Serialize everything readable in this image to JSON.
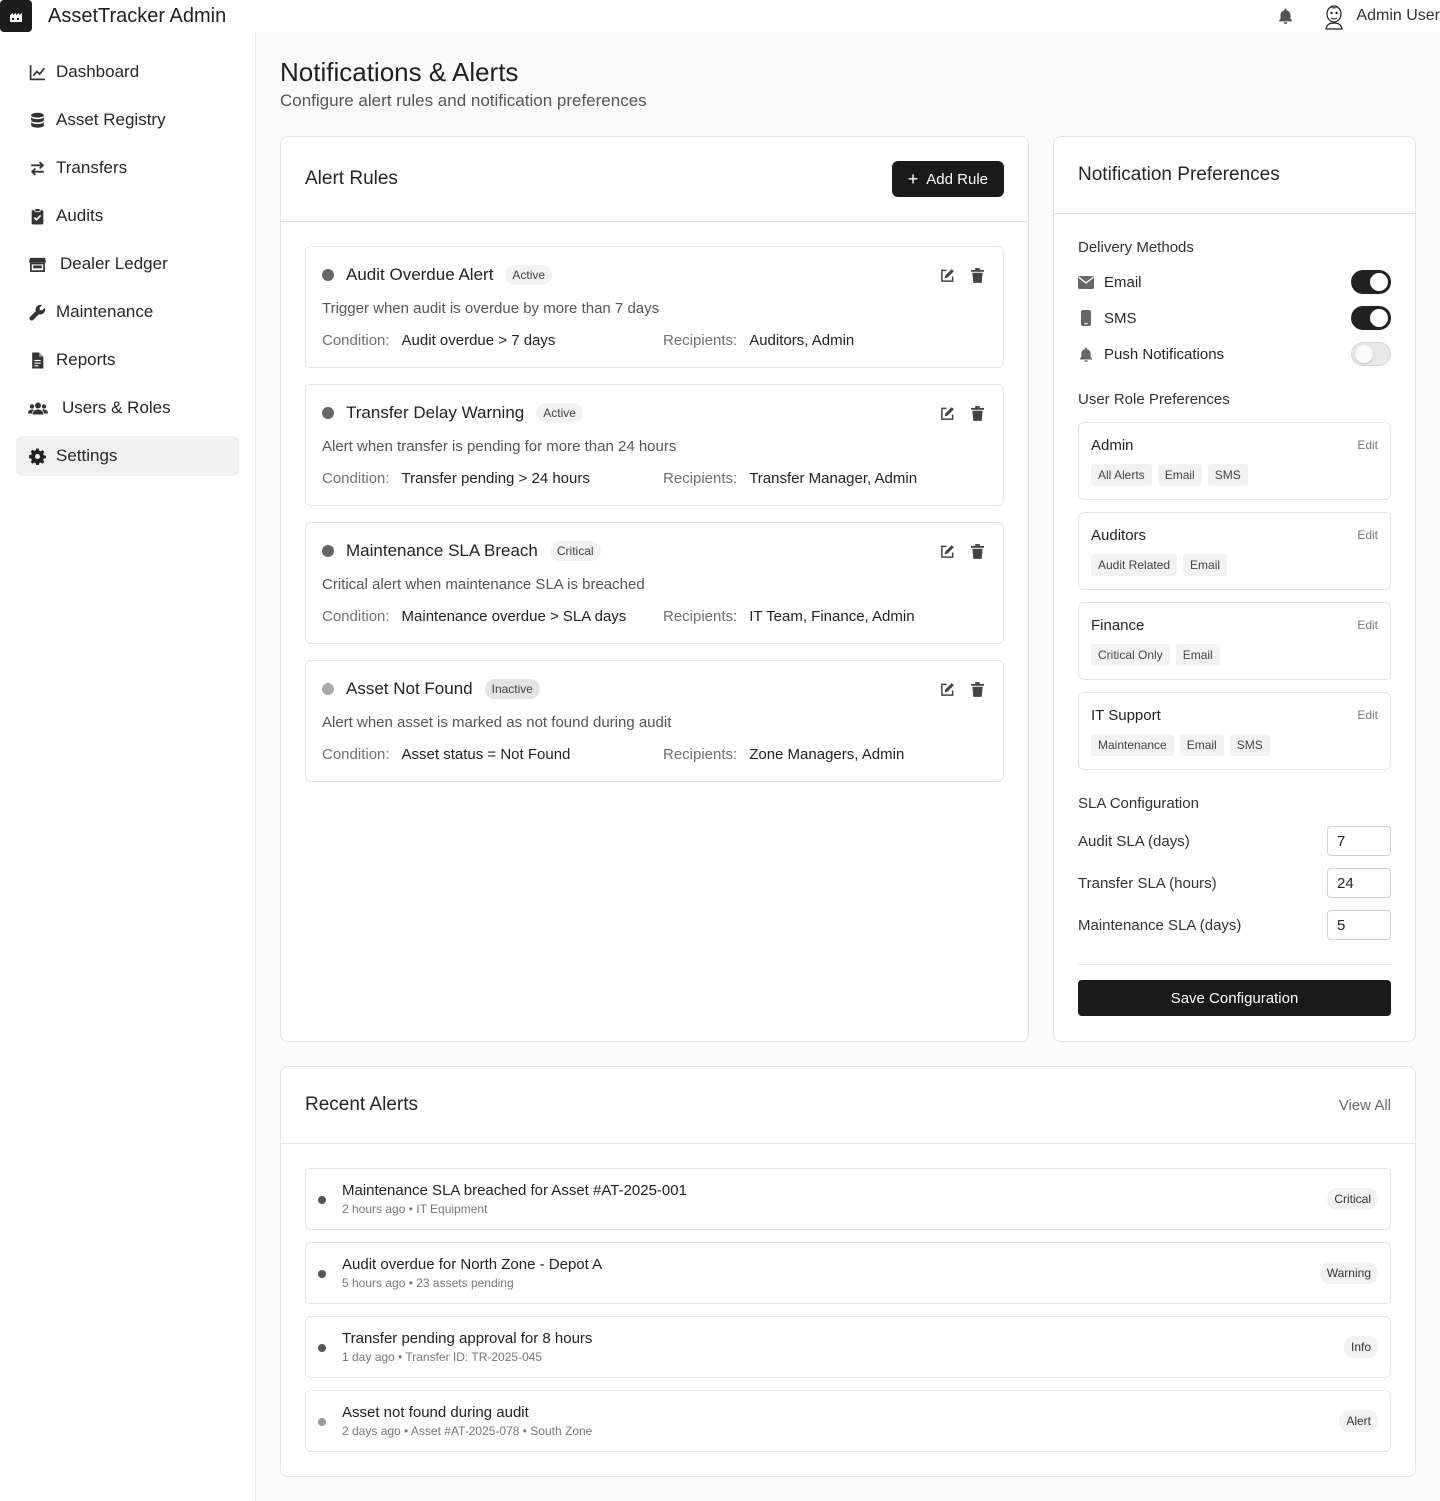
{
  "app": {
    "title": "AssetTracker Admin",
    "user": "Admin User"
  },
  "sidebar": {
    "items": [
      {
        "label": "Dashboard",
        "icon": "chart-line-icon"
      },
      {
        "label": "Asset Registry",
        "icon": "database-icon"
      },
      {
        "label": "Transfers",
        "icon": "arrows-exchange-icon"
      },
      {
        "label": "Audits",
        "icon": "clipboard-check-icon"
      },
      {
        "label": "Dealer Ledger",
        "icon": "store-icon"
      },
      {
        "label": "Maintenance",
        "icon": "wrench-icon"
      },
      {
        "label": "Reports",
        "icon": "file-icon"
      },
      {
        "label": "Users & Roles",
        "icon": "users-icon"
      },
      {
        "label": "Settings",
        "icon": "gear-icon",
        "active": true
      }
    ]
  },
  "page": {
    "title": "Notifications & Alerts",
    "subtitle": "Configure alert rules and notification preferences"
  },
  "alert_rules": {
    "title": "Alert Rules",
    "add_label": "Add Rule",
    "condition_key": "Condition:",
    "recipients_key": "Recipients:",
    "rules": [
      {
        "name": "Audit Overdue Alert",
        "status": "Active",
        "description": "Trigger when audit is overdue by more than 7 days",
        "condition": "Audit overdue > 7 days",
        "recipients": "Auditors, Admin"
      },
      {
        "name": "Transfer Delay Warning",
        "status": "Active",
        "description": "Alert when transfer is pending for more than 24 hours",
        "condition": "Transfer pending > 24 hours",
        "recipients": "Transfer Manager, Admin"
      },
      {
        "name": "Maintenance SLA Breach",
        "status": "Critical",
        "description": "Critical alert when maintenance SLA is breached",
        "condition": "Maintenance overdue > SLA days",
        "recipients": "IT Team, Finance, Admin"
      },
      {
        "name": "Asset Not Found",
        "status": "Inactive",
        "description": "Alert when asset is marked as not found during audit",
        "condition": "Asset status = Not Found",
        "recipients": "Zone Managers, Admin"
      }
    ]
  },
  "prefs": {
    "title": "Notification Preferences",
    "delivery_title": "Delivery Methods",
    "methods": [
      {
        "label": "Email",
        "enabled": true
      },
      {
        "label": "SMS",
        "enabled": true
      },
      {
        "label": "Push Notifications",
        "enabled": false
      }
    ],
    "roles_title": "User Role Preferences",
    "edit_label": "Edit",
    "roles": [
      {
        "name": "Admin",
        "tags": [
          "All Alerts",
          "Email",
          "SMS"
        ]
      },
      {
        "name": "Auditors",
        "tags": [
          "Audit Related",
          "Email"
        ]
      },
      {
        "name": "Finance",
        "tags": [
          "Critical Only",
          "Email"
        ]
      },
      {
        "name": "IT Support",
        "tags": [
          "Maintenance",
          "Email",
          "SMS"
        ]
      }
    ],
    "sla_title": "SLA Configuration",
    "sla": [
      {
        "label": "Audit SLA (days)",
        "value": "7"
      },
      {
        "label": "Transfer SLA (hours)",
        "value": "24"
      },
      {
        "label": "Maintenance SLA (days)",
        "value": "5"
      }
    ],
    "save_label": "Save Configuration"
  },
  "recent": {
    "title": "Recent Alerts",
    "view_all": "View All",
    "alerts": [
      {
        "title": "Maintenance SLA breached for Asset #AT-2025-001",
        "meta": "2 hours ago • IT Equipment",
        "level": "Critical"
      },
      {
        "title": "Audit overdue for North Zone - Depot A",
        "meta": "5 hours ago • 23 assets pending",
        "level": "Warning"
      },
      {
        "title": "Transfer pending approval for 8 hours",
        "meta": "1 day ago • Transfer ID: TR-2025-045",
        "level": "Info"
      },
      {
        "title": "Asset not found during audit",
        "meta": "2 days ago • Asset #AT-2025-078 • South Zone",
        "level": "Alert"
      }
    ]
  }
}
